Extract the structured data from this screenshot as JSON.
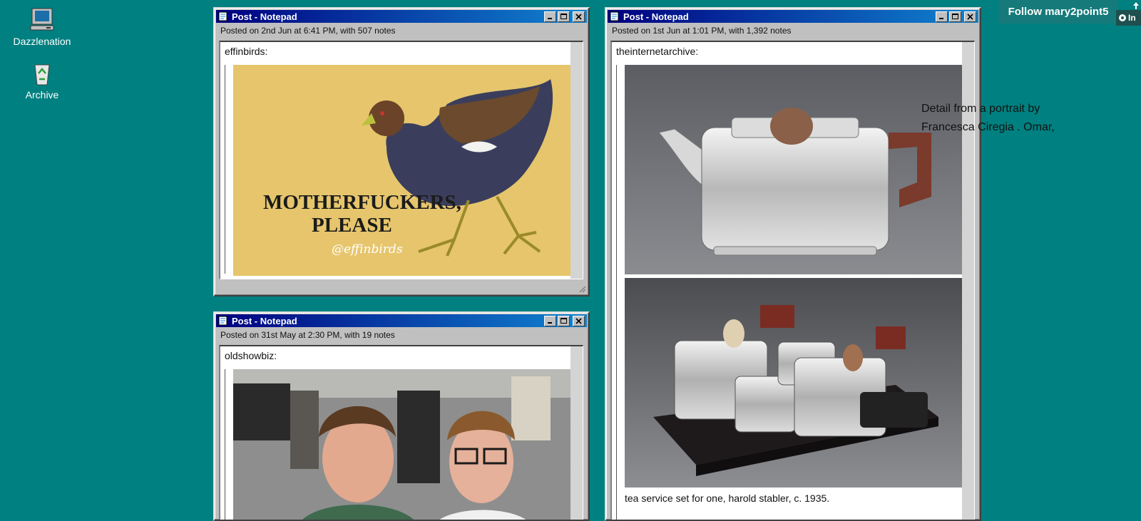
{
  "desktop": {
    "icons": [
      {
        "label": "Dazzlenation",
        "icon": "computer-icon"
      },
      {
        "label": "Archive",
        "icon": "recycle-bin-icon"
      }
    ]
  },
  "posts": [
    {
      "title": "Post - Notepad",
      "meta": "Posted on 2nd Jun at 6:41 PM, with 507 notes",
      "author": "effinbirds:",
      "image_text_line1": "MOTHERFUCKERS,",
      "image_text_line2": "PLEASE",
      "image_watermark": "@effinbirds"
    },
    {
      "title": "Post - Notepad",
      "meta": "Posted on 1st Jun at 1:01 PM, with 1,392 notes",
      "author": "theinternetarchive:",
      "caption": "tea service set for one, harold stabler, c. 1935."
    },
    {
      "title": "Post - Notepad",
      "meta": "Posted on 31st May at 2:30 PM, with 19 notes",
      "author": "oldshowbiz:"
    }
  ],
  "follow_button": "Follow mary2point5",
  "side_text": "Detail from a portrait by Francesca Ciregia .  Omar,",
  "corner_label": "In",
  "colors": {
    "desktop": "#008080",
    "titlebar_start": "#000080",
    "titlebar_end": "#1084d0",
    "window": "#c0c0c0"
  }
}
